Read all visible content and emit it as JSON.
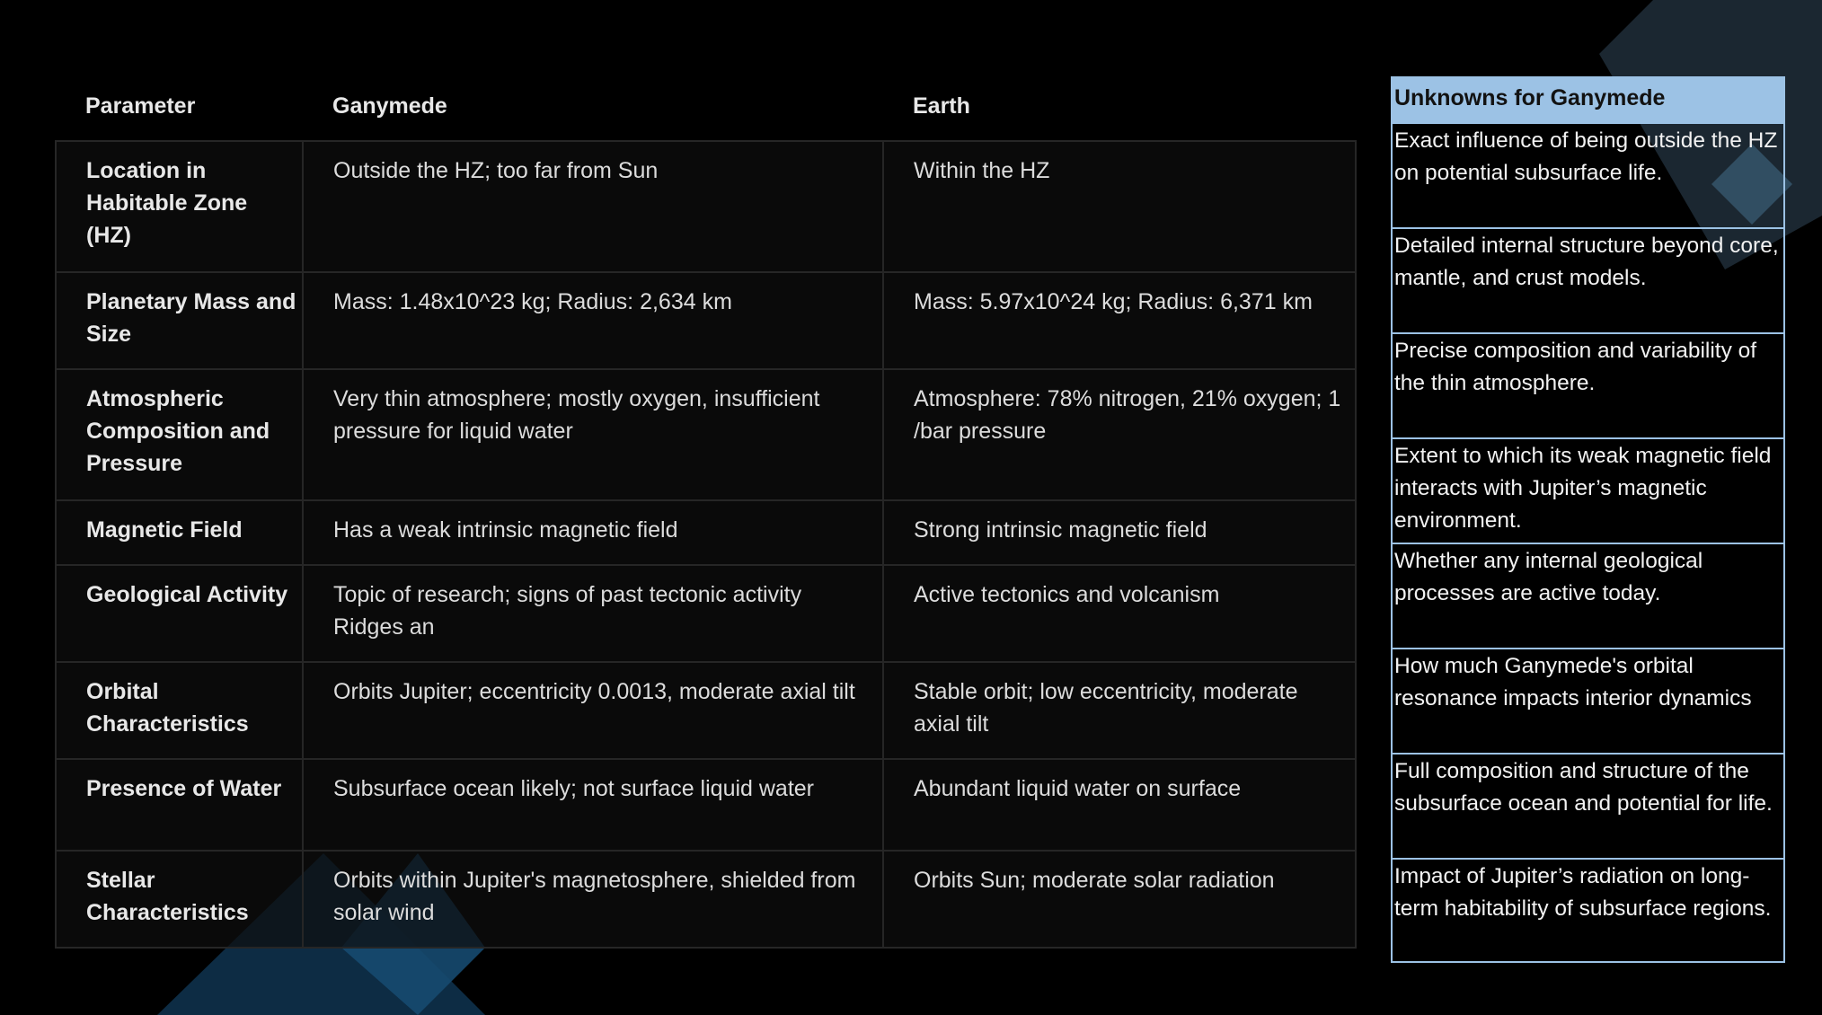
{
  "table": {
    "headers": [
      "Parameter",
      "Ganymede",
      "Earth"
    ],
    "rows": [
      {
        "parameter": "Location in Habitable Zone (HZ)",
        "ganymede": "Outside the HZ; too far from Sun",
        "earth": "Within the HZ"
      },
      {
        "parameter": "Planetary Mass and Size",
        "ganymede": "Mass: 1.48x10^23 kg; Radius: 2,634 km",
        "earth": "Mass: 5.97x10^24 kg; Radius: 6,371 km"
      },
      {
        "parameter": "Atmospheric Composition and Pressure",
        "ganymede": "Very thin atmosphere; mostly oxygen, insufficient pressure for liquid water",
        "earth": "Atmosphere: 78% nitrogen, 21% oxygen; 1 /bar pressure"
      },
      {
        "parameter": "Magnetic Field",
        "ganymede": "Has a weak intrinsic magnetic field",
        "earth": "Strong intrinsic magnetic field"
      },
      {
        "parameter": "Geological Activity",
        "ganymede": "Topic of research; signs of past tectonic activity Ridges an",
        "earth": "Active tectonics and volcanism"
      },
      {
        "parameter": "Orbital Characteristics",
        "ganymede": "Orbits Jupiter; eccentricity 0.0013, moderate axial tilt",
        "earth": "Stable orbit; low eccentricity, moderate axial tilt"
      },
      {
        "parameter": "Presence of Water",
        "ganymede": "Subsurface ocean likely; not surface liquid water",
        "earth": "Abundant liquid water on surface"
      },
      {
        "parameter": "Stellar Characteristics",
        "ganymede": "Orbits within Jupiter's magnetosphere, shielded from solar wind",
        "earth": "Orbits Sun; moderate solar radiation"
      }
    ]
  },
  "unknowns": {
    "title": "Unknowns for Ganymede",
    "items": [
      "Exact influence of being outside the HZ on potential subsurface life.",
      "Detailed internal structure beyond core, mantle, and crust models.",
      "Precise composition and variability of the thin atmosphere.",
      "Extent to which its weak magnetic field interacts with Jupiter’s magnetic environment.",
      "Whether any internal geological processes are active today.",
      "How much Ganymede's orbital resonance impacts interior dynamics",
      "Full composition and structure of the subsurface ocean and potential for life.",
      "Impact of Jupiter’s radiation on long-term habitability of subsurface regions."
    ]
  },
  "colors": {
    "background": "#000000",
    "unknowns_accent": "#9cc2e5",
    "decor_slate": "#1f2d38",
    "decor_blue": "#163a57"
  }
}
